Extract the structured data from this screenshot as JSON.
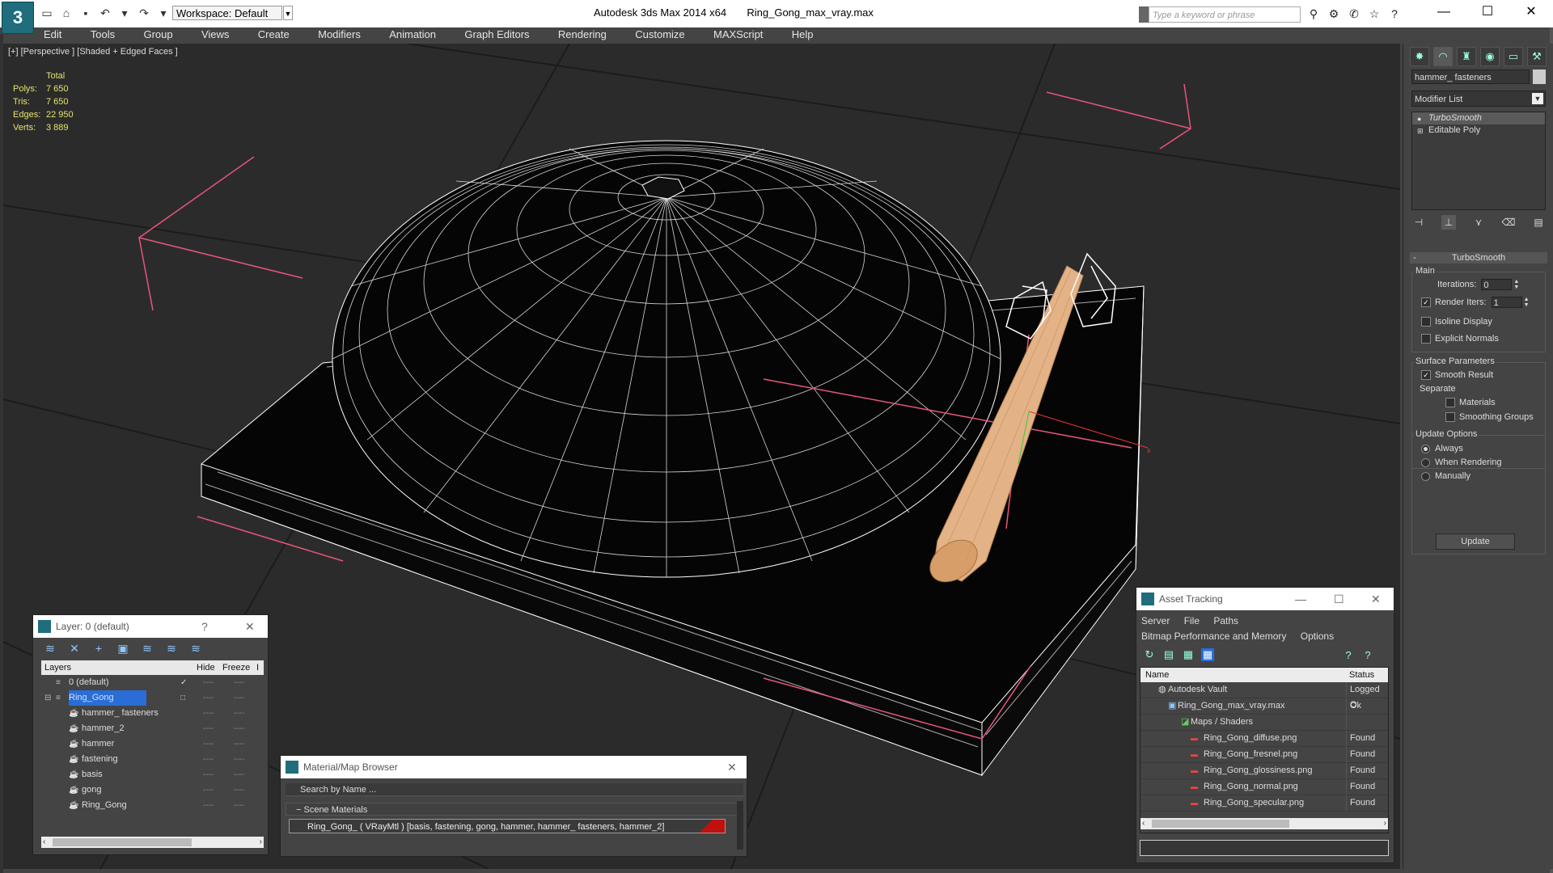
{
  "titlebar": {
    "logo": "3",
    "workspace": "Workspace: Default",
    "app_name": "Autodesk 3ds Max  2014 x64",
    "file_name": "Ring_Gong_max_vray.max",
    "search_placeholder": "Type a keyword or phrase"
  },
  "menu": [
    "Edit",
    "Tools",
    "Group",
    "Views",
    "Create",
    "Modifiers",
    "Animation",
    "Graph Editors",
    "Rendering",
    "Customize",
    "MAXScript",
    "Help"
  ],
  "viewport": {
    "label": "[+] [Perspective ] [Shaded + Edged Faces ]",
    "stats": {
      "header": "Total",
      "polys_label": "Polys:",
      "polys": "7 650",
      "tris_label": "Tris:",
      "tris": "7 650",
      "edges_label": "Edges:",
      "edges": "22 950",
      "verts_label": "Verts:",
      "verts": "3 889"
    },
    "colors": {
      "background": "#2b2b2b",
      "wire": "#ffffff",
      "selection_box": "#e8557a",
      "handle": "#e3b286"
    }
  },
  "command_panel": {
    "object_name": "hammer_ fasteners",
    "modifier_list": "Modifier List",
    "stack": [
      "TurboSmooth",
      "Editable Poly"
    ],
    "rollout_title": "TurboSmooth",
    "main_group": "Main",
    "iterations_label": "Iterations:",
    "iterations": "0",
    "render_iters_label": "Render Iters:",
    "render_iters": "1",
    "isoline_display": "Isoline Display",
    "explicit_normals": "Explicit Normals",
    "surface_params": "Surface Parameters",
    "smooth_result": "Smooth Result",
    "separate": "Separate",
    "materials": "Materials",
    "smoothing_groups": "Smoothing Groups",
    "update_options": "Update Options",
    "always": "Always",
    "when_rendering": "When Rendering",
    "manually": "Manually",
    "update_button": "Update"
  },
  "layer_window": {
    "title": "Layer: 0 (default)",
    "help": "?",
    "col_layers": "Layers",
    "col_hide": "Hide",
    "col_freeze": "Freeze",
    "col_extra": "I",
    "rows": [
      {
        "name": "0 (default)",
        "indent": 1
      },
      {
        "name": "Ring_Gong",
        "indent": 1
      },
      {
        "name": "hammer_ fasteners",
        "indent": 2
      },
      {
        "name": "hammer_2",
        "indent": 2
      },
      {
        "name": "hammer",
        "indent": 2
      },
      {
        "name": "fastening",
        "indent": 2
      },
      {
        "name": "basis",
        "indent": 2
      },
      {
        "name": "gong",
        "indent": 2
      },
      {
        "name": "Ring_Gong",
        "indent": 2
      }
    ],
    "dash": "----"
  },
  "material_browser": {
    "title": "Material/Map Browser",
    "search_placeholder": "Search by Name ...",
    "section": "Scene Materials",
    "item": "Ring_Gong_  ( VRayMtl )  [basis, fastening, gong, hammer, hammer_ fasteners, hammer_2]"
  },
  "asset_tracking": {
    "title": "Asset Tracking",
    "menu1": [
      "Server",
      "File",
      "Paths"
    ],
    "menu2": [
      "Bitmap Performance and Memory",
      "Options"
    ],
    "col_name": "Name",
    "col_status": "Status",
    "rows": [
      {
        "name": "Autodesk Vault",
        "status": "Logged O"
      },
      {
        "name": "Ring_Gong_max_vray.max",
        "status": "Ok"
      },
      {
        "name": "Maps / Shaders",
        "status": ""
      },
      {
        "name": "Ring_Gong_diffuse.png",
        "status": "Found"
      },
      {
        "name": "Ring_Gong_fresnel.png",
        "status": "Found"
      },
      {
        "name": "Ring_Gong_glossiness.png",
        "status": "Found"
      },
      {
        "name": "Ring_Gong_normal.png",
        "status": "Found"
      },
      {
        "name": "Ring_Gong_specular.png",
        "status": "Found"
      }
    ]
  }
}
